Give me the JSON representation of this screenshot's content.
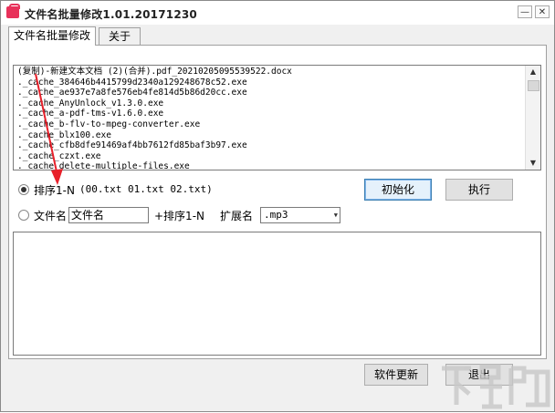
{
  "window": {
    "title": "文件名批量修改1.01.20171230",
    "minimize": "—",
    "close": "✕"
  },
  "tabs": [
    {
      "label": "文件名批量修改",
      "active": true
    },
    {
      "label": "关于",
      "active": false
    }
  ],
  "file_list": [
    "(复制)-新建文本文档 (2)(合并).pdf_20210205095539522.docx",
    "._cache_384646b4415799d2340a129248678c52.exe",
    "._cache_ae937e7a8fe576eb4fe814d5b86d20cc.exe",
    "._cache_AnyUnlock_v1.3.0.exe",
    "._cache_a-pdf-tms-v1.6.0.exe",
    "._cache_b-flv-to-mpeg-converter.exe",
    "._cache_blx100.exe",
    "._cache_cfb8dfe91469af4bb7612fd85baf3b97.exe",
    "._cache_czxt.exe",
    "._cache_delete-multiple-files.exe"
  ],
  "options": {
    "sort_label": "排序1-N",
    "sort_example": "(00.txt  01.txt 02.txt)",
    "sort_selected": true,
    "filename_label": "文件名",
    "filename_value": "文件名",
    "plus_sort_label": "+排序1-N",
    "ext_label": "扩展名",
    "ext_value": ".mp3"
  },
  "buttons": {
    "init": "初始化",
    "execute": "执行",
    "update": "软件更新",
    "exit": "退出"
  },
  "watermark": "下载吧"
}
